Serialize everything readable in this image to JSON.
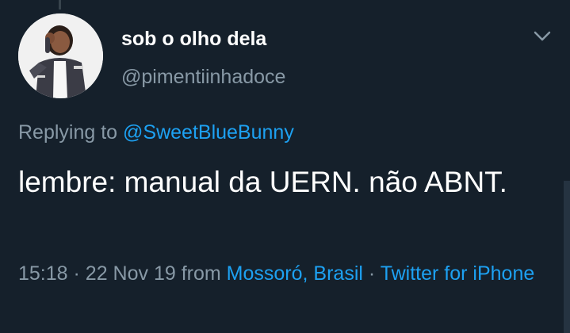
{
  "author": {
    "display_name": "sob o olho dela",
    "handle": "@pimentiinhadoce"
  },
  "reply": {
    "prefix": "Replying to",
    "mention": "@SweetBlueBunny"
  },
  "tweet": {
    "text": "lembre: manual da UERN. não ABNT."
  },
  "meta": {
    "time": "15:18",
    "separator1": "·",
    "date": "22 Nov 19",
    "from_word": "from",
    "location": "Mossoró, Brasil",
    "separator2": "·",
    "source": "Twitter for iPhone"
  },
  "icons": {
    "more": "chevron-down-icon",
    "avatar": "profile-photo"
  },
  "colors": {
    "background": "#15202b",
    "primary_text": "#ffffff",
    "secondary_text": "#8899a6",
    "accent": "#1da1f2"
  }
}
